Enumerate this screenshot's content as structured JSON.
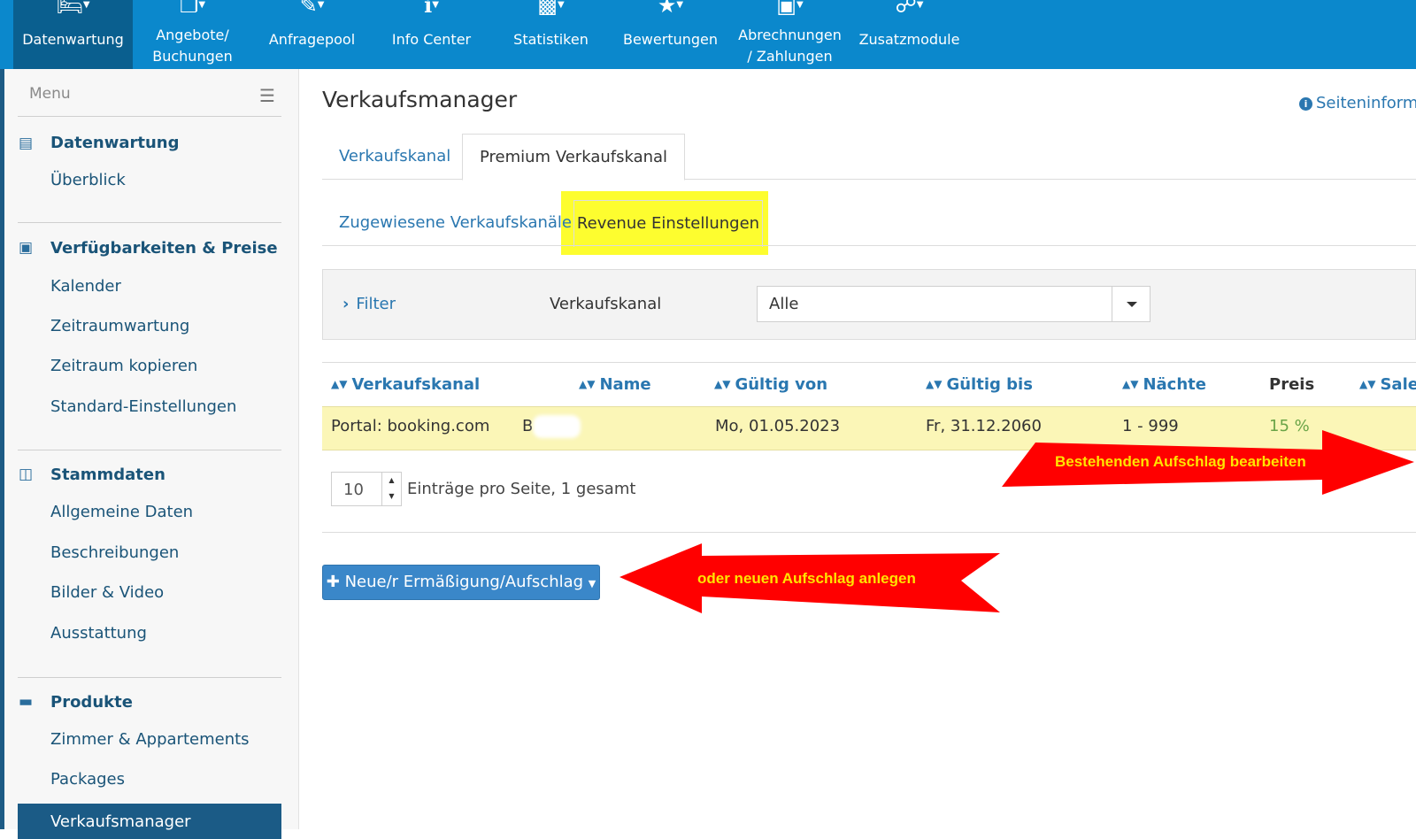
{
  "topnav": {
    "items": [
      {
        "label": "Datenwartung",
        "icon": "bed-icon",
        "active": true
      },
      {
        "label": "Angebote/",
        "label2": "Buchungen",
        "icon": "documents-icon"
      },
      {
        "label": "Anfragepool",
        "icon": "pencil-paper-icon"
      },
      {
        "label": "Info Center",
        "icon": "info-icon"
      },
      {
        "label": "Statistiken",
        "icon": "bar-chart-icon"
      },
      {
        "label": "Bewertungen",
        "icon": "star-icon"
      },
      {
        "label": "Abrechnungen",
        "label2": "/ Zahlungen",
        "icon": "money-icon"
      },
      {
        "label": "Zusatzmodule",
        "icon": "share-icon"
      }
    ]
  },
  "sidebar": {
    "menu_label": "Menu",
    "sections": [
      {
        "title": "Datenwartung",
        "icon": "document-icon",
        "items": [
          "Überblick"
        ]
      },
      {
        "title": "Verfügbarkeiten & Preise",
        "icon": "money-icon",
        "items": [
          "Kalender",
          "Zeitraumwartung",
          "Zeitraum kopieren",
          "Standard-Einstellungen"
        ]
      },
      {
        "title": "Stammdaten",
        "icon": "columns-icon",
        "items": [
          "Allgemeine Daten",
          "Beschreibungen",
          "Bilder & Video",
          "Ausstattung"
        ]
      },
      {
        "title": "Produkte",
        "icon": "bed-icon",
        "items": [
          "Zimmer & Appartements",
          "Packages"
        ]
      }
    ],
    "active_item": "Verkaufsmanager"
  },
  "page": {
    "title": "Verkaufsmanager",
    "info_link": "Seiteninforma",
    "tabs": [
      "Verkaufskanal",
      "Premium Verkaufskanal"
    ],
    "subtabs": [
      "Zugewiesene Verkaufskanäle",
      "Revenue Einstellungen"
    ],
    "highlight_color": "#fdfd2f"
  },
  "filter": {
    "toggle_label": "Filter",
    "field_label": "Verkaufskanal",
    "selected": "Alle"
  },
  "table": {
    "headers": [
      "Verkaufskanal",
      "Name",
      "Gültig von",
      "Gültig bis",
      "Nächte",
      "Preis",
      "Salesl"
    ],
    "rows": [
      {
        "verkaufskanal": "Portal: booking.com",
        "name": "B",
        "von": "Mo, 01.05.2023",
        "bis": "Fr, 31.12.2060",
        "naechte": "1 - 999",
        "preis": "15 %"
      }
    ],
    "page_size": "10",
    "pager_text": "Einträge pro Seite, 1 gesamt"
  },
  "actions": {
    "new_button": "Neue/r Ermäßigung/Aufschlag"
  },
  "annotations": {
    "edit": "Bestehenden Aufschlag bearbeiten",
    "create": "oder neuen Aufschlag anlegen",
    "arrow_color": "#ff0000",
    "text_color": "#ffe400"
  }
}
